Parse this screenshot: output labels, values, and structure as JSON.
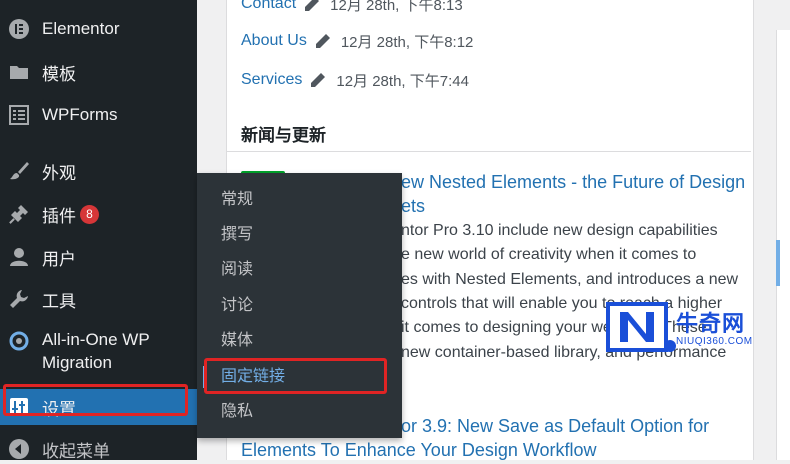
{
  "sidebar": {
    "items": [
      {
        "label": "Elementor",
        "icon": "elementor-icon"
      },
      {
        "label": "模板",
        "icon": "folder-icon"
      },
      {
        "label": "WPForms",
        "icon": "form-icon"
      },
      {
        "label": "外观",
        "icon": "brush-icon"
      },
      {
        "label": "插件",
        "icon": "plugin-icon",
        "badge": "8"
      },
      {
        "label": "用户",
        "icon": "user-icon"
      },
      {
        "label": "工具",
        "icon": "wrench-icon"
      },
      {
        "label": "All-in-One WP Migration",
        "label_line1": "All-in-One WP",
        "label_line2": "Migration",
        "icon": "migration-icon"
      },
      {
        "label": "设置",
        "icon": "settings-icon",
        "active": true
      },
      {
        "label": "收起菜单",
        "icon": "collapse-icon"
      }
    ]
  },
  "settings_submenu": {
    "items": [
      "常规",
      "撰写",
      "阅读",
      "讨论",
      "媒体",
      "固定链接",
      "隐私"
    ],
    "current": "固定链接"
  },
  "recent_pages": [
    {
      "title": "Contact",
      "date": "12月 28th, 下午8:13"
    },
    {
      "title": "About Us",
      "date": "12月 28th, 下午8:12"
    },
    {
      "title": "Services",
      "date": "12月 28th, 下午7:44"
    }
  ],
  "news": {
    "title": "新闻与更新",
    "item1": {
      "title_line1": "ew Nested Elements - the Future of Design",
      "title_line2": "ets",
      "body_lines": [
        "ntor Pro 3.10 include new design capabilities",
        "e new world of creativity when it comes to",
        "es with Nested Elements, and introduces a new",
        "controls that will enable you to reach a higher",
        " it comes to designing your websites. These",
        " new container-based library, and performance"
      ]
    },
    "item2": {
      "title_line1": "or 3.9: New Save as Default Option for",
      "title_line2": "Elements To Enhance Your Design Workflow"
    }
  },
  "watermark": {
    "text": "牛奇网",
    "sub": "NIUQI360.COM"
  },
  "colors": {
    "sidebar_bg": "#1d2327",
    "flyout_bg": "#2c3338",
    "link": "#2271b1",
    "active": "#2271b1",
    "badge": "#d63638",
    "highlight_box": "#e02424",
    "watermark_blue": "#1a4fd8"
  }
}
